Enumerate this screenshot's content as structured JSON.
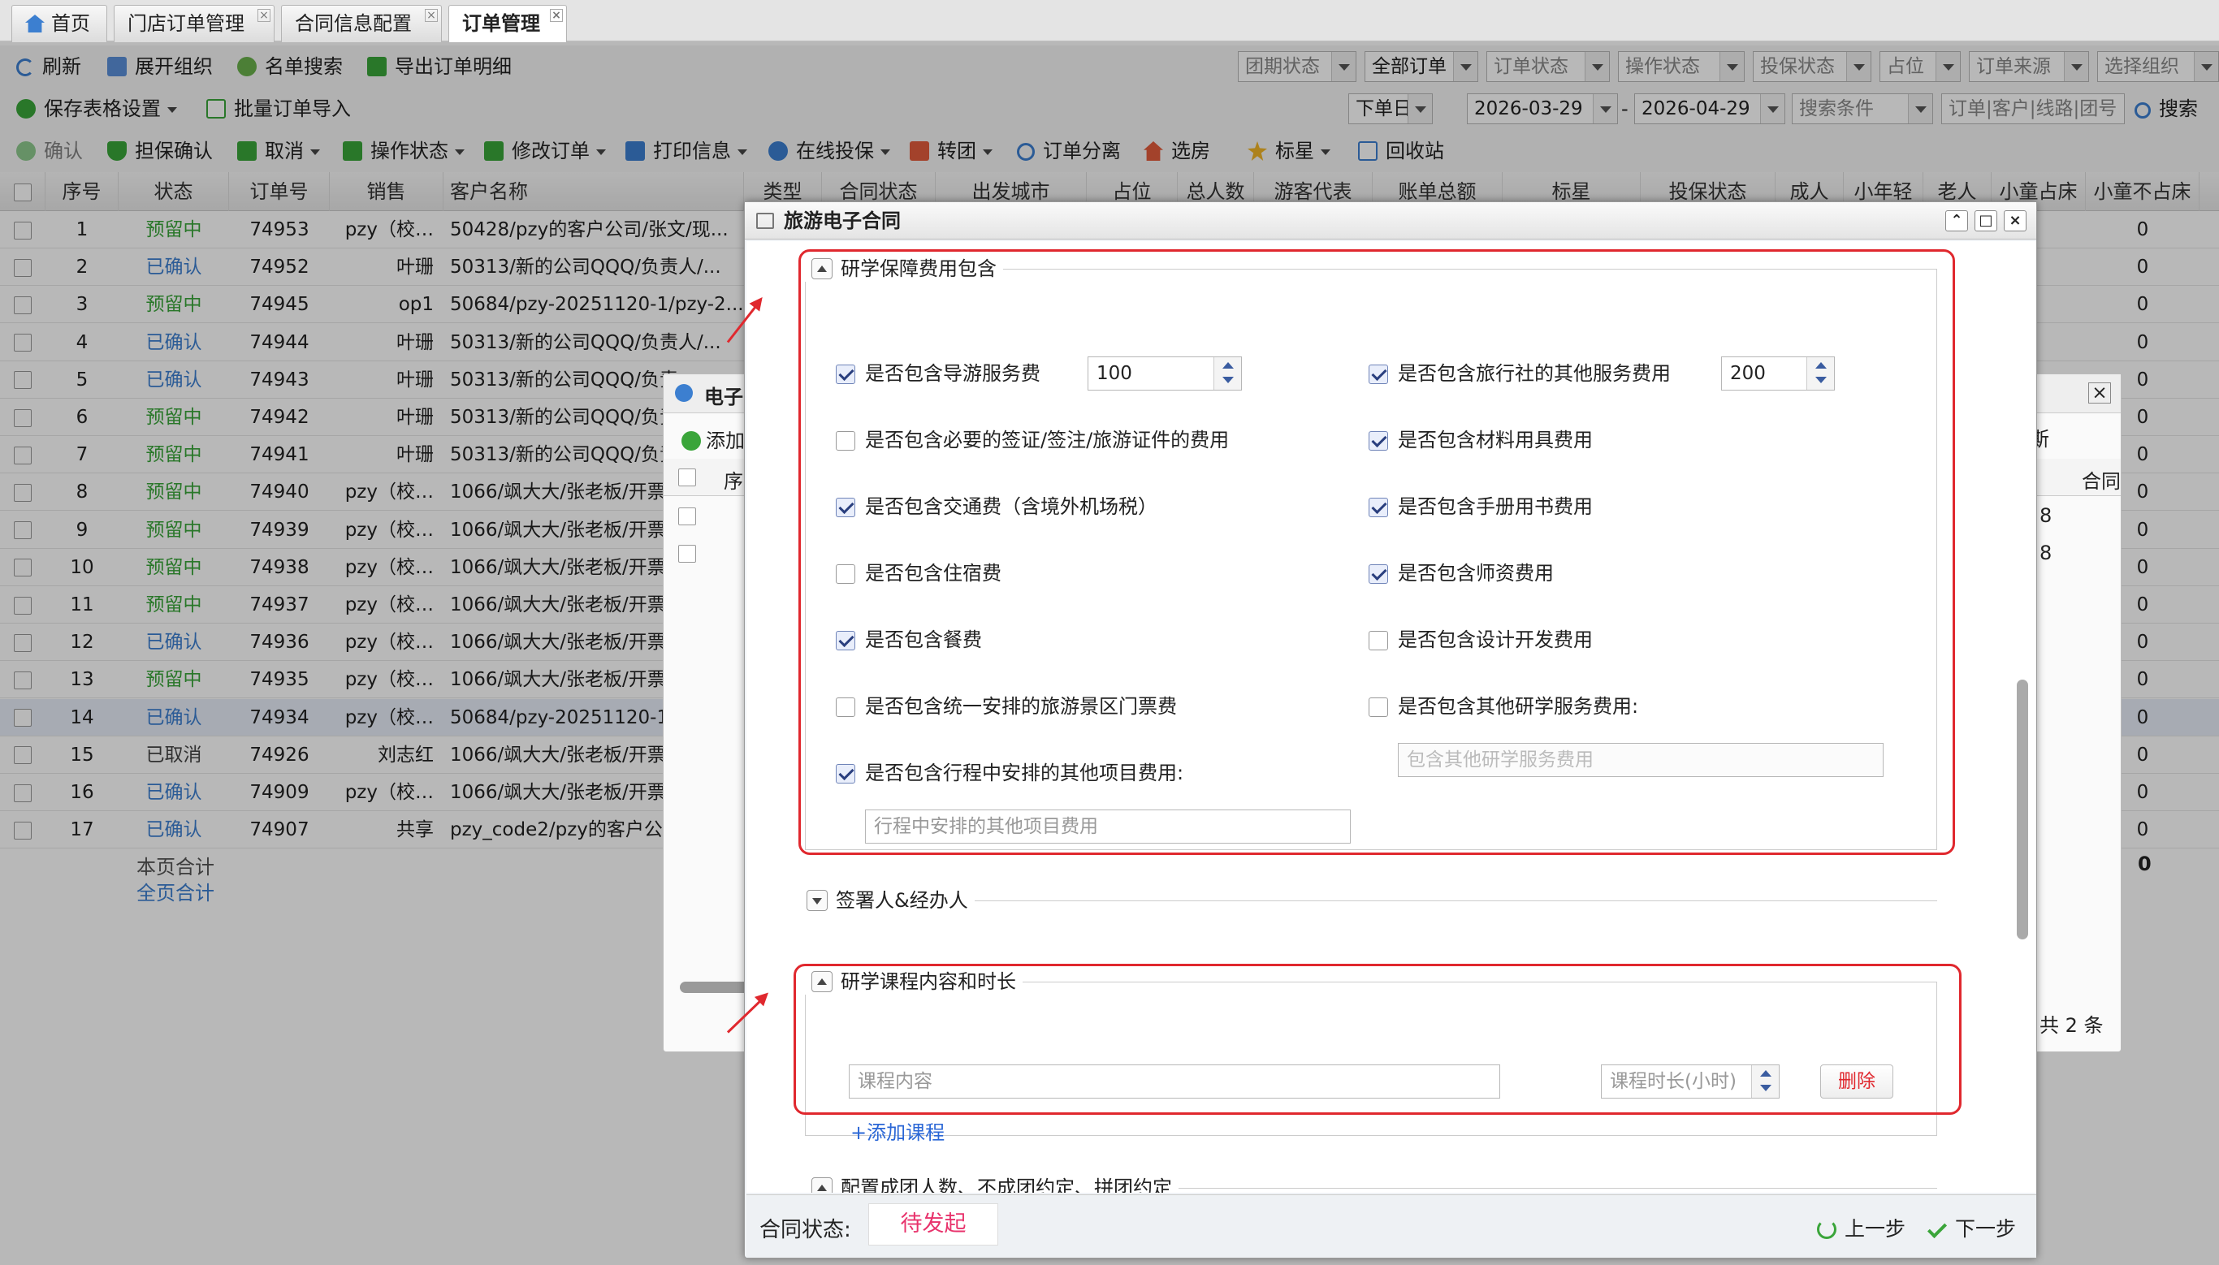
{
  "tabs": [
    {
      "label": "首页",
      "active": false
    },
    {
      "label": "门店订单管理",
      "active": false
    },
    {
      "label": "合同信息配置",
      "active": false
    },
    {
      "label": "订单管理",
      "active": true
    }
  ],
  "toolbar1": {
    "refresh": "刷新",
    "expand": "展开组织",
    "name_search": "名单搜索",
    "export": "导出订单明细"
  },
  "filters1": [
    "团期状态",
    "全部订单",
    "订单状态",
    "操作状态",
    "投保状态",
    "占位",
    "订单来源",
    "选择组织"
  ],
  "toolbar2": {
    "save_table": "保存表格设置",
    "batch_import": "批量订单导入"
  },
  "filters2": {
    "date_type": "下单日期",
    "date_from": "2026-03-29",
    "date_sep": "-",
    "date_to": "2026-04-29",
    "search_cond": "搜索条件",
    "keyword_placeholder": "订单|客户|线路|团号",
    "search": "搜索"
  },
  "toolbar3": {
    "confirm": "确认",
    "guarantee": "担保确认",
    "cancel": "取消",
    "op_status": "操作状态",
    "modify": "修改订单",
    "print": "打印信息",
    "insure": "在线投保",
    "transfer": "转团",
    "split": "订单分离",
    "room": "选房",
    "flag": "标星",
    "recycle": "回收站"
  },
  "grid": {
    "headers": [
      "序号",
      "状态",
      "订单号",
      "销售",
      "客户名称",
      "类型",
      "合同状态",
      "出发城市",
      "占位",
      "总人数",
      "游客代表",
      "账单总额",
      "标星",
      "投保状态",
      "成人",
      "小年轻",
      "老人",
      "小童占床",
      "小童不占床"
    ],
    "rows": [
      {
        "no": "1",
        "status": "预留中",
        "order": "74953",
        "sales": "pzy（校…",
        "customer": "50428/pzy的客户公司/张文/现...",
        "last": "0",
        "checked": false
      },
      {
        "no": "2",
        "status": "已确认",
        "order": "74952",
        "sales": "叶珊",
        "customer": "50313/新的公司QQQ/负责人/...",
        "last": "0",
        "checked": false
      },
      {
        "no": "3",
        "status": "预留中",
        "order": "74945",
        "sales": "op1",
        "customer": "50684/pzy-20251120-1/pzy-2...",
        "last": "0",
        "checked": false
      },
      {
        "no": "4",
        "status": "已确认",
        "order": "74944",
        "sales": "叶珊",
        "customer": "50313/新的公司QQQ/负责人/...",
        "last": "0",
        "checked": false
      },
      {
        "no": "5",
        "status": "已确认",
        "order": "74943",
        "sales": "叶珊",
        "customer": "50313/新的公司QQQ/负责",
        "last": "0",
        "checked": false
      },
      {
        "no": "6",
        "status": "预留中",
        "order": "74942",
        "sales": "叶珊",
        "customer": "50313/新的公司QQQ/负责",
        "last": "0",
        "checked": false
      },
      {
        "no": "7",
        "status": "预留中",
        "order": "74941",
        "sales": "叶珊",
        "customer": "50313/新的公司QQQ/负责",
        "last": "0",
        "checked": false
      },
      {
        "no": "8",
        "status": "预留中",
        "order": "74940",
        "sales": "pzy（校…",
        "customer": "1066/飒大大/张老板/开票",
        "last": "0",
        "checked": false
      },
      {
        "no": "9",
        "status": "预留中",
        "order": "74939",
        "sales": "pzy（校…",
        "customer": "1066/飒大大/张老板/开票",
        "last": "0",
        "checked": false
      },
      {
        "no": "10",
        "status": "预留中",
        "order": "74938",
        "sales": "pzy（校…",
        "customer": "1066/飒大大/张老板/开票",
        "last": "0",
        "checked": false
      },
      {
        "no": "11",
        "status": "预留中",
        "order": "74937",
        "sales": "pzy（校…",
        "customer": "1066/飒大大/张老板/开票",
        "last": "0",
        "checked": false
      },
      {
        "no": "12",
        "status": "已确认",
        "order": "74936",
        "sales": "pzy（校…",
        "customer": "1066/飒大大/张老板/开票",
        "last": "0",
        "checked": false
      },
      {
        "no": "13",
        "status": "预留中",
        "order": "74935",
        "sales": "pzy（校…",
        "customer": "1066/飒大大/张老板/开票",
        "last": "0",
        "checked": false
      },
      {
        "no": "14",
        "status": "已确认",
        "order": "74934",
        "sales": "pzy（校…",
        "customer": "50684/pzy-20251120-1/p",
        "last": "0",
        "checked": true
      },
      {
        "no": "15",
        "status": "已取消",
        "order": "74926",
        "sales": "刘志红",
        "customer": "1066/飒大大/张老板/开票",
        "last": "0",
        "checked": false
      },
      {
        "no": "16",
        "status": "已确认",
        "order": "74909",
        "sales": "pzy（校…",
        "customer": "1066/飒大大/张老板/开票",
        "last": "0",
        "checked": false
      },
      {
        "no": "17",
        "status": "已确认",
        "order": "74907",
        "sales": "共享",
        "customer": "pzy_code2/pzy的客户公司",
        "last": "0",
        "checked": false
      }
    ],
    "page_total": "本页合计",
    "all_total": "全页合计",
    "total_value": "0"
  },
  "bg_window": {
    "title": "电子",
    "add": "添加",
    "col_seq": "序",
    "col_contract": "合同",
    "val1": "8",
    "val2": "8",
    "partial_label": "斯",
    "total": "共 2 条"
  },
  "dialog": {
    "title": "旅游电子合同",
    "section1": {
      "title": "研学保障费用包含",
      "items": [
        {
          "label": "是否包含导游服务费",
          "checked": true,
          "value": "100"
        },
        {
          "label": "是否包含旅行社的其他服务费用",
          "checked": true,
          "value": "200"
        },
        {
          "label": "是否包含必要的签证/签注/旅游证件的费用",
          "checked": false
        },
        {
          "label": "是否包含材料用具费用",
          "checked": true
        },
        {
          "label": "是否包含交通费（含境外机场税）",
          "checked": true
        },
        {
          "label": "是否包含手册用书费用",
          "checked": true
        },
        {
          "label": "是否包含住宿费",
          "checked": false
        },
        {
          "label": "是否包含师资费用",
          "checked": true
        },
        {
          "label": "是否包含餐费",
          "checked": true
        },
        {
          "label": "是否包含设计开发费用",
          "checked": false
        },
        {
          "label": "是否包含统一安排的旅游景区门票费",
          "checked": false
        },
        {
          "label": "是否包含其他研学服务费用:",
          "checked": false
        },
        {
          "label": "是否包含行程中安排的其他项目费用:",
          "checked": true
        }
      ],
      "other_service_placeholder": "包含其他研学服务费用",
      "other_project_placeholder": "行程中安排的其他项目费用"
    },
    "section2": {
      "title": "签署人&经办人"
    },
    "section3": {
      "title": "研学课程内容和时长",
      "course_placeholder": "课程内容",
      "duration_placeholder": "课程时长(小时)",
      "delete": "删除",
      "add_course": "+添加课程"
    },
    "section4": {
      "title": "配置成团人数、不成团约定、拼团约定"
    },
    "footer": {
      "status_label": "合同状态:",
      "status_value": "待发起",
      "prev": "上一步",
      "next": "下一步"
    }
  },
  "colors": {
    "green": "#3aa53a",
    "blue": "#3c7fd0",
    "red": "#e0282e",
    "pink": "#e8336c",
    "link": "#2b67d6"
  }
}
